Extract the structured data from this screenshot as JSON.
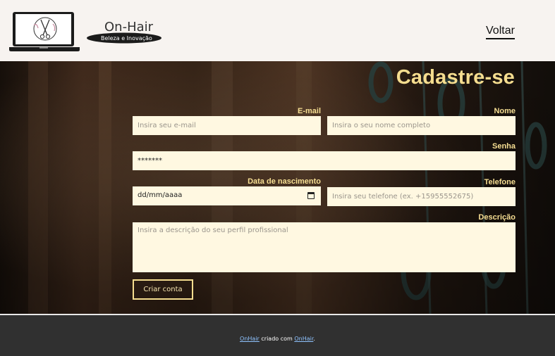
{
  "header": {
    "brand_name": "On-Hair",
    "brand_tagline": "Beleza e Inovação",
    "back_link": "Voltar"
  },
  "form": {
    "title": "Cadastre-se",
    "email": {
      "label": "E-mail",
      "placeholder": "Insira seu e-mail"
    },
    "name": {
      "label": "Nome",
      "placeholder": "Insira o seu nome completo"
    },
    "password": {
      "label": "Senha",
      "value": "*******"
    },
    "birthdate": {
      "label": "Data de nascimento",
      "value": "dd/mm/aaaa"
    },
    "phone": {
      "label": "Telefone",
      "placeholder": "Insira seu telefone (ex. +15955552675)"
    },
    "description": {
      "label": "Descrição",
      "placeholder": "Insira a descrição do seu perfil profissional"
    },
    "submit_label": "Criar conta"
  },
  "footer": {
    "link1": "OnHair",
    "middle": " criado com ",
    "link2": "OnHair",
    "end": "."
  },
  "colors": {
    "accent": "#f5dd8f",
    "input_bg": "#fff8e1",
    "header_bg": "#f7f3f0",
    "footer_bg": "#303030"
  }
}
